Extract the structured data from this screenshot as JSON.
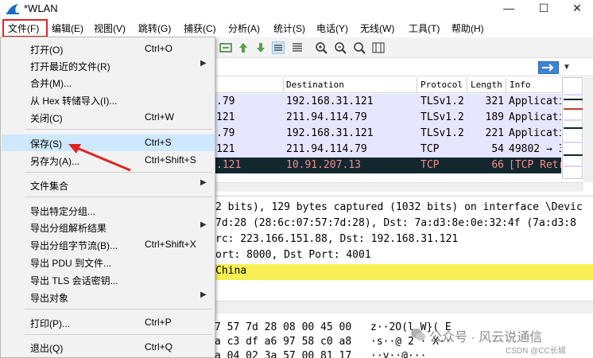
{
  "window": {
    "title": "*WLAN",
    "minimize_glyph": "—",
    "maximize_glyph": "☐",
    "close_glyph": "✕"
  },
  "menubar": {
    "items": [
      "文件(F)",
      "编辑(E)",
      "视图(V)",
      "跳转(G)",
      "捕获(C)",
      "分析(A)",
      "统计(S)",
      "电话(Y)",
      "无线(W)",
      "工具(T)",
      "帮助(H)"
    ]
  },
  "file_menu": {
    "items": [
      {
        "label": "打开(O)",
        "shortcut": "Ctrl+O"
      },
      {
        "label": "打开最近的文件(R)",
        "submenu": true
      },
      {
        "label": "合并(M)..."
      },
      {
        "label": "从 Hex 转储导入(I)..."
      },
      {
        "label": "关闭(C)",
        "shortcut": "Ctrl+W"
      },
      {
        "label": "保存(S)",
        "shortcut": "Ctrl+S",
        "highlighted": true
      },
      {
        "label": "另存为(A)...",
        "shortcut": "Ctrl+Shift+S"
      },
      {
        "label": "文件集合",
        "submenu": true
      },
      {
        "label": "导出特定分组..."
      },
      {
        "label": "导出分组解析结果",
        "submenu": true
      },
      {
        "label": "导出分组字节流(B)...",
        "shortcut": "Ctrl+Shift+X"
      },
      {
        "label": "导出 PDU 到文件..."
      },
      {
        "label": "导出 TLS 会话密钥..."
      },
      {
        "label": "导出对象",
        "submenu": true
      },
      {
        "label": "打印(P)...",
        "shortcut": "Ctrl+P"
      },
      {
        "label": "退出(Q)",
        "shortcut": "Ctrl+Q"
      }
    ]
  },
  "packet_list": {
    "headers": [
      "Destination",
      "Protocol",
      "Length",
      "Info"
    ],
    "rows": [
      {
        "src": ".79",
        "dst": "192.168.31.121",
        "proto": "TLSv1.2",
        "len": "321",
        "info": "Applicati"
      },
      {
        "src": "121",
        "dst": "211.94.114.79",
        "proto": "TLSv1.2",
        "len": "189",
        "info": "Applicati"
      },
      {
        "src": ".79",
        "dst": "192.168.31.121",
        "proto": "TLSv1.2",
        "len": "221",
        "info": "Applicati"
      },
      {
        "src": "121",
        "dst": "211.94.114.79",
        "proto": "TCP",
        "len": "54",
        "info": "49802 → 3"
      },
      {
        "src": ".121",
        "dst": "10.91.207.13",
        "proto": "TCP",
        "len": "66",
        "info": "[TCP Retr"
      }
    ]
  },
  "details": {
    "lines": [
      "2 bits), 129 bytes captured (1032 bits) on interface \\Devic",
      "7d:28 (28:6c:07:57:7d:28), Dst: 7a:d3:8e:0e:32:4f (7a:d3:8",
      "rc: 223.166.151.88, Dst: 192.168.31.121",
      "ort: 8000, Dst Port: 4001",
      "China"
    ]
  },
  "bytes": {
    "lines": [
      {
        "hex": "7 57 7d 28 08 00 45 00",
        "ascii": "z··2O(l W}( E"
      },
      {
        "hex": "a c3 df a6 97 58 c0 a8",
        "ascii": "·s··@ 2 · X··"
      },
      {
        "hex": "a 04 02 3a 57 00 81 17",
        "ascii": "··y··@···"
      }
    ]
  },
  "watermark": {
    "text": "公众号 · 风云说通信",
    "sub": "CSDN @CC长城"
  },
  "colors": {
    "tls_row": "#e7e6ff",
    "selected_row_bg": "#12272e",
    "selected_row_fg": "#f78b8b",
    "menu_highlight": "#cde8ff",
    "detail_highlight": "#f6f054",
    "annotation_red": "#e02424"
  }
}
